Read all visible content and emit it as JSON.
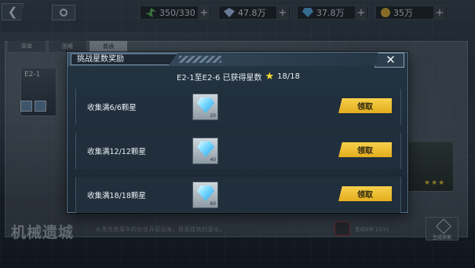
{
  "topbar": {
    "resources": [
      {
        "icon": "stamina-icon",
        "value": "350/330"
      },
      {
        "icon": "gem-icon",
        "value": "47.8万"
      },
      {
        "icon": "crystal-icon",
        "value": "37.8万"
      },
      {
        "icon": "coin-icon",
        "value": "35万"
      }
    ]
  },
  "background": {
    "tabs": [
      "简单",
      "困难",
      "普通"
    ],
    "stage_label": "E2-1",
    "area_title": "机械遗城",
    "description": "从黑色铁笼中的仪仗兵营出发，探索建筑的遗址。",
    "box_text": "遗城探索 15/15",
    "right_button_label": "生成探索"
  },
  "modal": {
    "title": "挑战星数奖励",
    "summary_text": "E2-1至E2-6 已获得星数",
    "summary_count": "18/18",
    "rewards": [
      {
        "label": "收集满6/6颗星",
        "quantity": "20",
        "button": "领取"
      },
      {
        "label": "收集满12/12颗星",
        "quantity": "40",
        "button": "领取"
      },
      {
        "label": "收集满18/18颗星",
        "quantity": "60",
        "button": "领取"
      }
    ]
  },
  "colors": {
    "claim_button": "#f0c233",
    "star": "#f4da35",
    "modal_bg": "#1f2d3a"
  }
}
